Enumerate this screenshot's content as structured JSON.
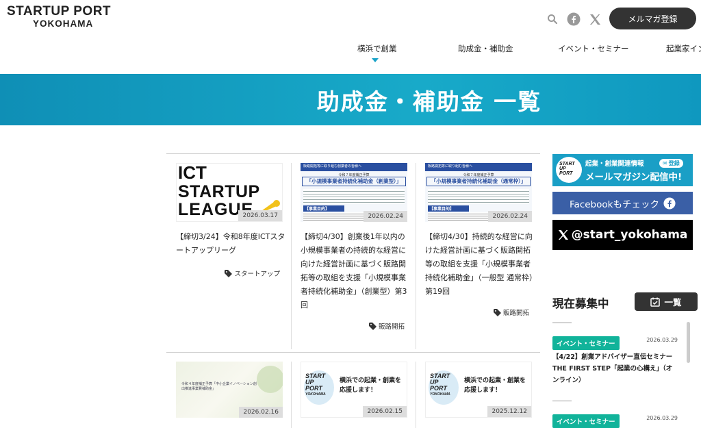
{
  "header": {
    "logo_main": "STARTUP PORT",
    "logo_sub": "YOKOHAMA",
    "icons": [
      "search-icon",
      "facebook-icon",
      "x-icon"
    ],
    "mail_button": "メルマガ登録"
  },
  "nav": {
    "items": [
      "横浜で創業",
      "助成金・補助金",
      "イベント・セミナー",
      "起業家イン"
    ],
    "active_index": 0
  },
  "hero": {
    "title": "助成金・補助金 一覧"
  },
  "cards": [
    {
      "thumb_lines": [
        "ICT",
        "STARTUP",
        "LEAGUE"
      ],
      "date": "2026.03.17",
      "title": "【締切3/24】令和8年度ICTスタートアップリーグ",
      "tag": "スタートアップ"
    },
    {
      "thumb_title": "「小規模事業者持続化補助金（創業型）」",
      "thumb_header": "販路開拓等に取り組む創業者の皆様へ",
      "thumb_sub": "令和７年度補正予算",
      "thumb_body": "【事業目的】",
      "date": "2026.02.24",
      "title": "【締切4/30】創業後1年以内の小規模事業者の持続的な経営に向けた経営計画に基づく販路開拓等の取組を支援「小規模事業者持続化補助金」（創業型）第3回",
      "tag": "販路開拓"
    },
    {
      "thumb_title": "「小規模事業者持続化補助金（通常枠）」",
      "thumb_header": "販路開拓等に取り組む皆様へ",
      "thumb_sub": "令和７年度補正予算",
      "thumb_body": "【事業目的】",
      "date": "2026.02.24",
      "title": "【締切4/30】持続的な経営に向けた経営計画に基づく販路開拓等の取組を支援「小規模事業者持続化補助金」（一般型 通常枠）第19回",
      "tag": "販路開拓"
    },
    {
      "thumb_text": "令和４年度補正予算「中小企業イノベーション創出推進事業費補助金」",
      "date": "2026.02.16"
    },
    {
      "thumb_text": "横浜での起業・創業を応援します！",
      "logo_lines": [
        "START",
        "UP",
        "PORT",
        "YOKOHAMA"
      ],
      "date": "2026.02.15"
    },
    {
      "thumb_text": "横浜での起業・創業を応援します！",
      "logo_lines": [
        "START",
        "UP",
        "PORT",
        "YOKOHAMA"
      ],
      "date": "2025.12.12"
    }
  ],
  "sidebar": {
    "banner1_line1": "起業・創業関連情報",
    "banner1_line2": "メールマガジン配信中!",
    "banner1_badge": "登録",
    "banner2": "Facebookもチェック",
    "banner3": "@start_yokohama",
    "recruit_title": "現在募集中",
    "recruit_button": "一覧",
    "events": [
      {
        "badge": "イベント・セミナー",
        "date": "2026.03.29",
        "title": "【4/22】創業アドバイザー直伝セミナー THE FIRST STEP「起業の心構え」（オンライン）"
      },
      {
        "badge": "イベント・セミナー",
        "date": "2026.03.29"
      }
    ]
  },
  "colors": {
    "hero": "#18aac9",
    "accent": "#1aa3c8",
    "event_badge": "#11b39a",
    "facebook": "#3a5fa6"
  }
}
